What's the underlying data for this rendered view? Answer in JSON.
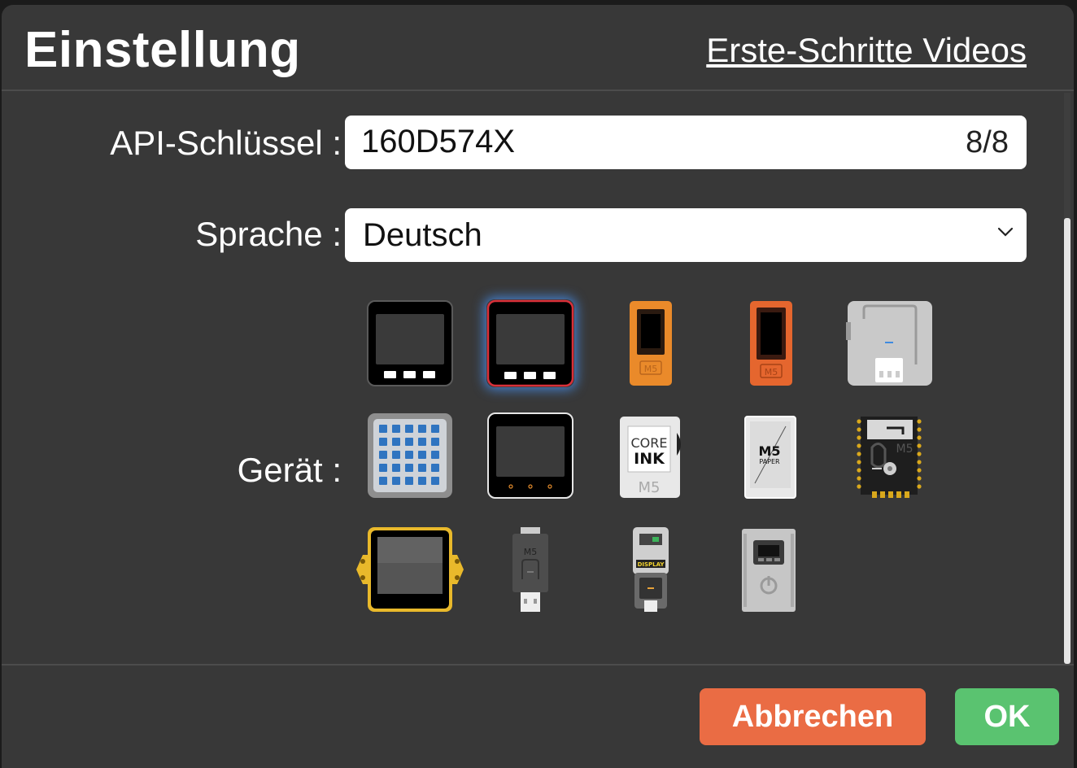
{
  "dialog": {
    "title": "Einstellung",
    "videos_link": "Erste-Schritte Videos"
  },
  "api_key": {
    "label": "API-Schlüssel :",
    "value": "160D574X",
    "counter": "8/8"
  },
  "language": {
    "label": "Sprache :",
    "selected": "Deutsch"
  },
  "device": {
    "label": "Gerät :",
    "selected_index": 1,
    "items": [
      {
        "name": "m5stack-basic"
      },
      {
        "name": "m5stack-core2"
      },
      {
        "name": "m5stickc"
      },
      {
        "name": "m5stickc-plus"
      },
      {
        "name": "atom-lite"
      },
      {
        "name": "atom-matrix"
      },
      {
        "name": "m5stack-core2-black"
      },
      {
        "name": "coreink",
        "text_top": "CORE",
        "text_bottom": "INK",
        "logo": "M5"
      },
      {
        "name": "m5paper",
        "text_top": "M5",
        "text_bottom": "PAPER"
      },
      {
        "name": "stamp-pico",
        "logo": "M5"
      },
      {
        "name": "core2-aws"
      },
      {
        "name": "atom-u",
        "logo": "M5"
      },
      {
        "name": "atom-display",
        "logo": "DISPLAY"
      },
      {
        "name": "station"
      }
    ]
  },
  "buttons": {
    "cancel": "Abbrechen",
    "ok": "OK"
  },
  "colors": {
    "dialog_bg": "#383838",
    "cancel": "#ea6c44",
    "ok": "#5ac370",
    "selection_glow": "#468ce6",
    "stick_orange": "#ea8a2a",
    "stick_red_orange": "#e5662e",
    "aws_gold": "#e9b92b"
  }
}
